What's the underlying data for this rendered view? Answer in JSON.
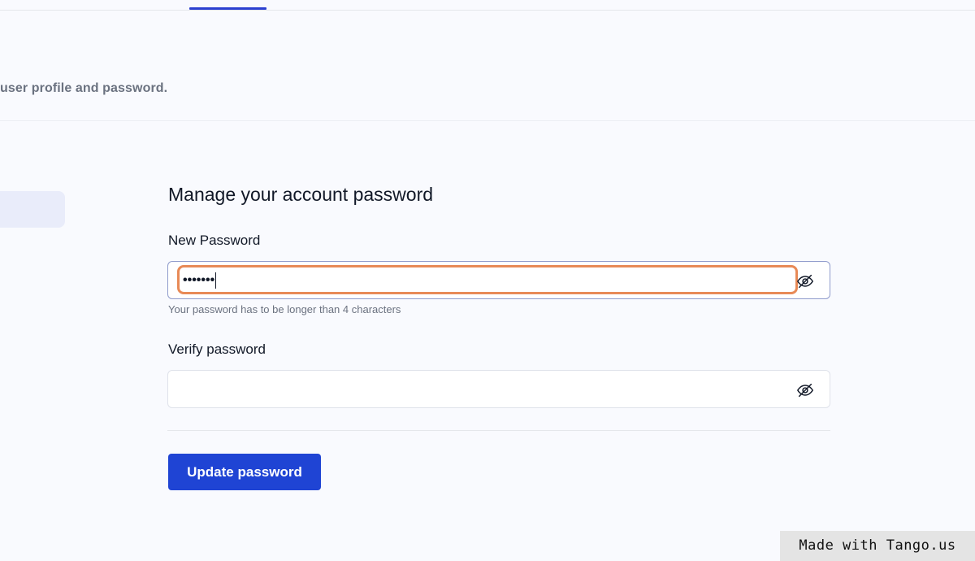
{
  "header": {
    "subtitle": "user profile and password."
  },
  "form": {
    "title": "Manage your account password",
    "new_password": {
      "label": "New Password",
      "value": "•••••••",
      "hint": "Your password has to be longer than 4 characters",
      "toggle_icon": "eye-off-icon"
    },
    "verify_password": {
      "label": "Verify password",
      "value": "",
      "toggle_icon": "eye-off-icon"
    },
    "submit_label": "Update password"
  },
  "watermark": {
    "text": "Made with Tango.us"
  },
  "colors": {
    "accent": "#1f44d4",
    "focus_ring": "#e88a57",
    "active_nav_bg": "#e9ecfa"
  }
}
